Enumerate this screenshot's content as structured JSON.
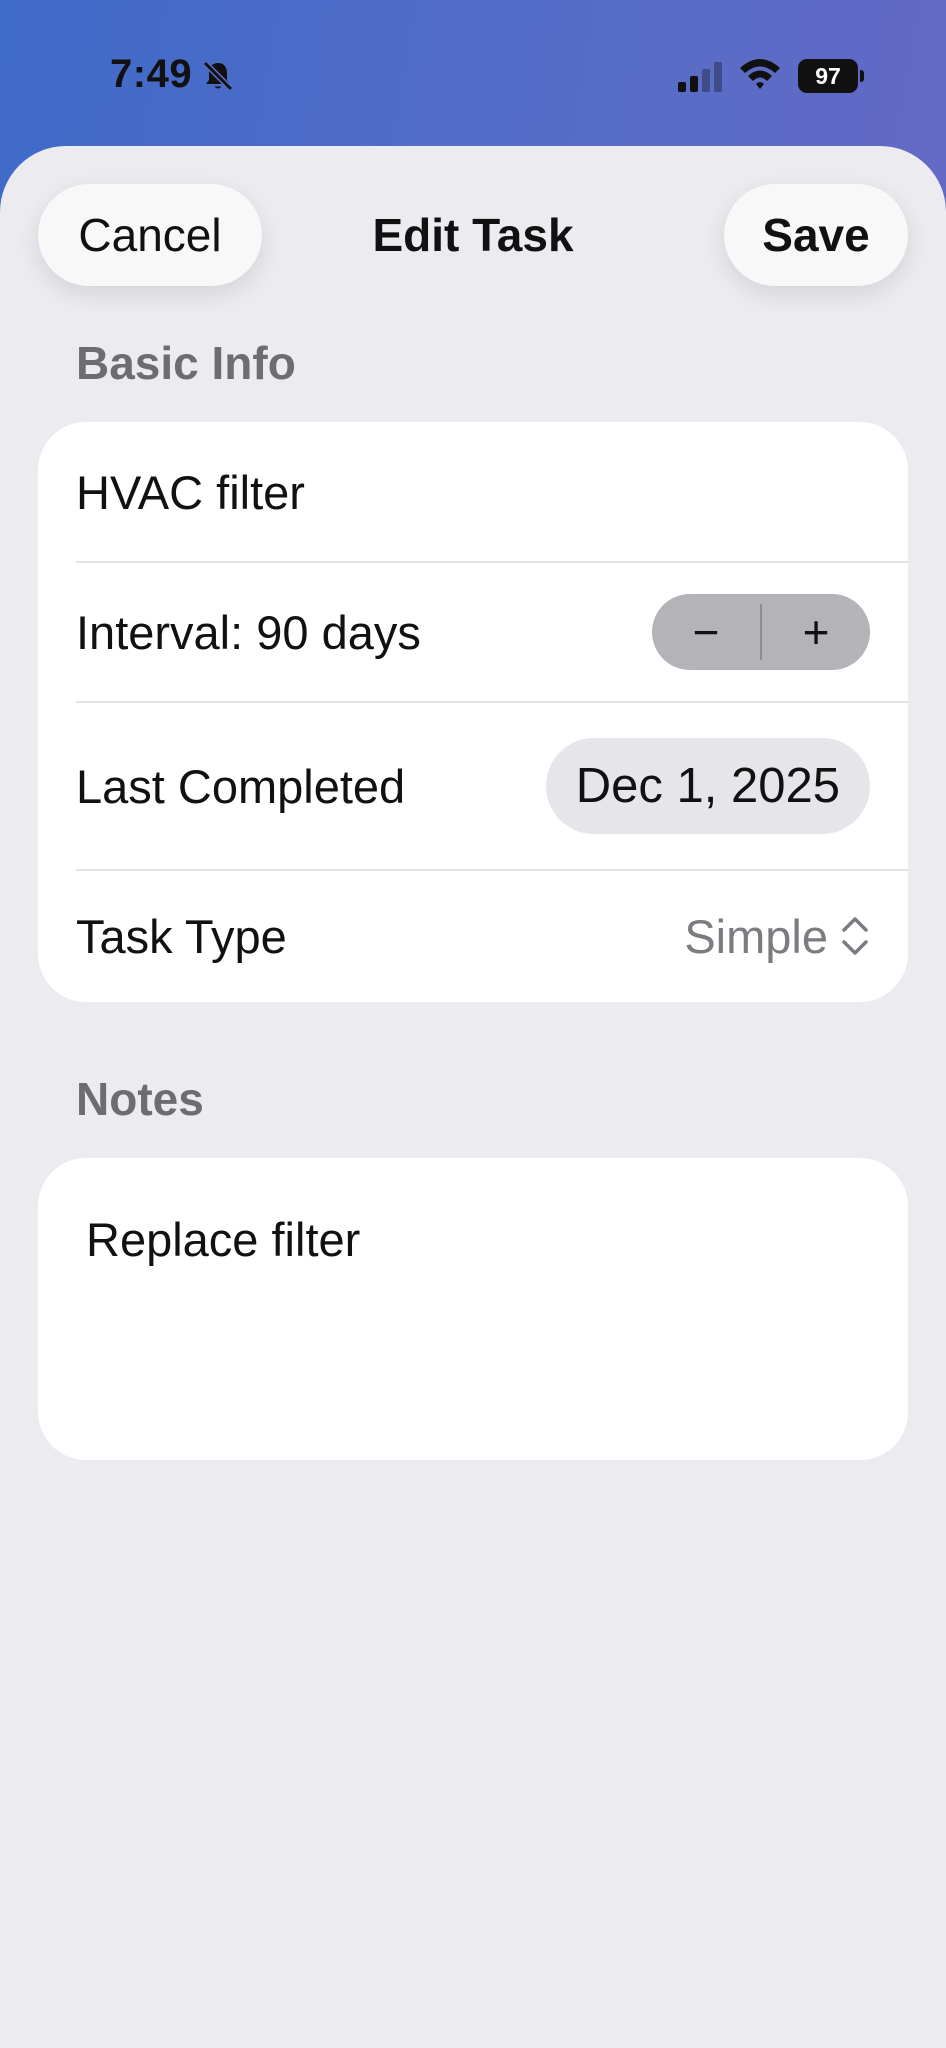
{
  "status_bar": {
    "time": "7:49",
    "battery_level": "97",
    "icons": [
      "bell-slash-icon",
      "cellular-signal-icon",
      "wifi-icon",
      "battery-icon"
    ]
  },
  "nav": {
    "cancel_label": "Cancel",
    "title": "Edit Task",
    "save_label": "Save"
  },
  "basic_info": {
    "header": "Basic Info",
    "title_value": "HVAC filter",
    "interval_label": "Interval: 90 days",
    "stepper_minus": "−",
    "stepper_plus": "+",
    "last_completed_label": "Last Completed",
    "last_completed_value": "Dec 1, 2025",
    "task_type_label": "Task Type",
    "task_type_value": "Simple"
  },
  "notes": {
    "header": "Notes",
    "text": "Replace filter"
  },
  "colors": {
    "gradient_start": "#3f6bc9",
    "gradient_end": "#6d66c4",
    "sheet_background": "#ebebf0",
    "card_background": "#ffffff",
    "secondary_text": "#6c6c72",
    "stepper_background": "#b3b3b8"
  }
}
